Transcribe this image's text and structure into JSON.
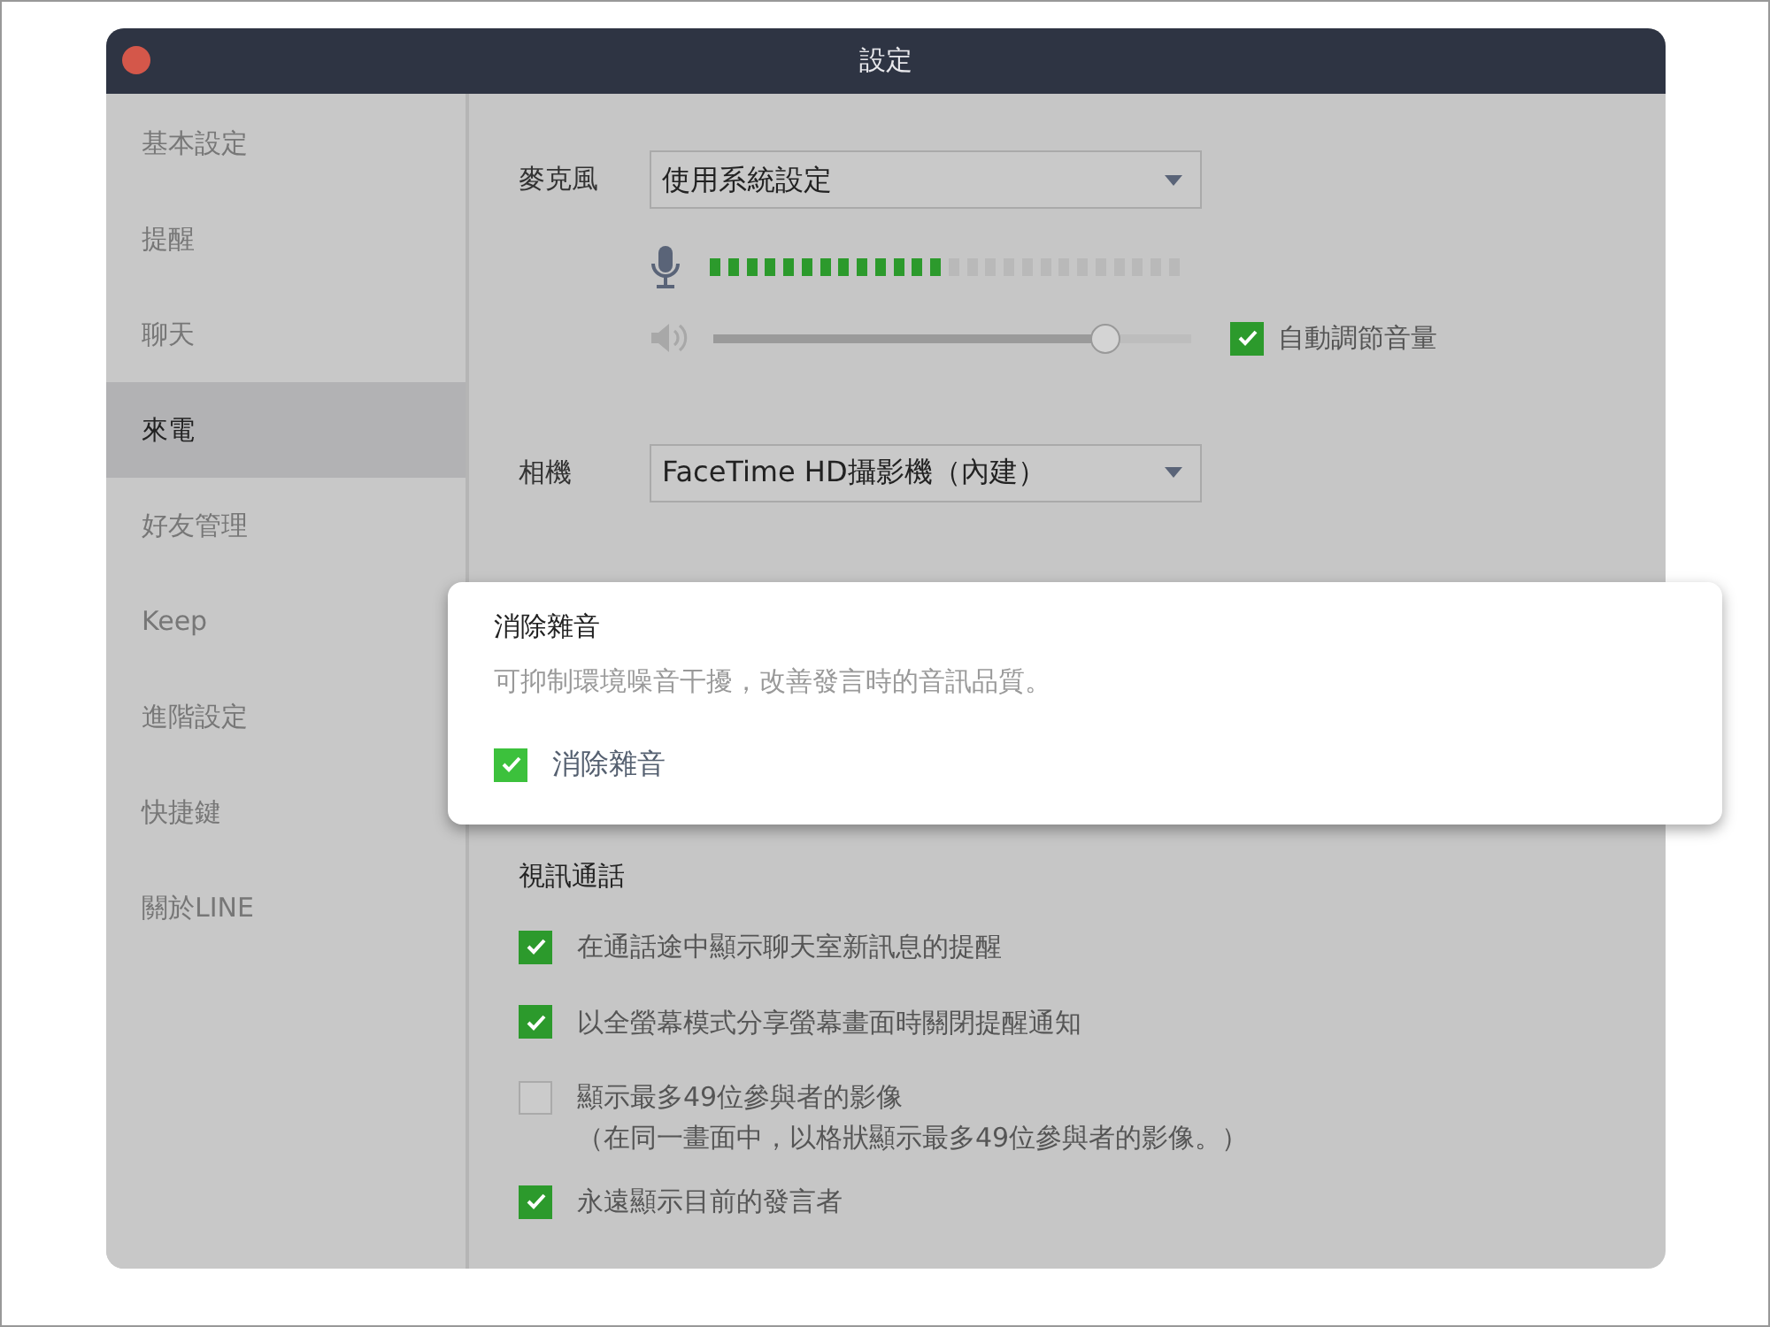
{
  "window": {
    "title": "設定"
  },
  "sidebar": {
    "items": [
      {
        "label": "基本設定",
        "selected": false
      },
      {
        "label": "提醒",
        "selected": false
      },
      {
        "label": "聊天",
        "selected": false
      },
      {
        "label": "來電",
        "selected": true
      },
      {
        "label": "好友管理",
        "selected": false
      },
      {
        "label": "Keep",
        "selected": false
      },
      {
        "label": "進階設定",
        "selected": false
      },
      {
        "label": "快捷鍵",
        "selected": false
      },
      {
        "label": "關於LINE",
        "selected": false
      }
    ]
  },
  "microphone": {
    "label": "麥克風",
    "device": "使用系統設定",
    "meter": {
      "level": 0.5
    },
    "volume": {
      "level": 0.82
    },
    "auto_adjust": {
      "label": "自動調節音量",
      "checked": true
    }
  },
  "camera": {
    "label": "相機",
    "device": "FaceTime HD攝影機（內建）"
  },
  "popup": {
    "title": "消除雜音",
    "description": "可抑制環境噪音干擾，改善發言時的音訊品質。",
    "checkbox": {
      "label": "消除雜音",
      "checked": true
    }
  },
  "video_call": {
    "title": "視訊通話",
    "options": [
      {
        "label": "在通話途中顯示聊天室新訊息的提醒",
        "checked": true
      },
      {
        "label": "以全螢幕模式分享螢幕畫面時關閉提醒通知",
        "checked": true
      },
      {
        "label": "顯示最多49位參與者的影像",
        "note": "（在同一畫面中，以格狀顯示最多49位參與者的影像。）",
        "checked": false
      },
      {
        "label": "永遠顯示目前的發言者",
        "checked": true
      }
    ]
  }
}
